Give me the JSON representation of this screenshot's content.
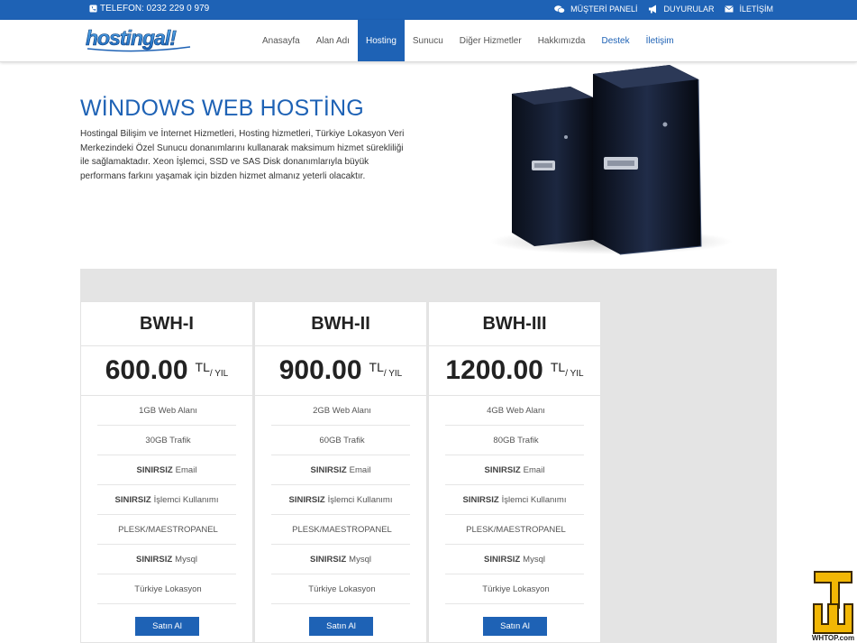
{
  "topbar": {
    "phone": "TELEFON: 0232 229 0 979",
    "links": [
      {
        "label": "MÜŞTERİ PANELİ",
        "icon": "chat-icon"
      },
      {
        "label": "DUYURULAR",
        "icon": "megaphone-icon"
      },
      {
        "label": "İLETİŞİM",
        "icon": "mail-icon"
      }
    ]
  },
  "logo": {
    "text": "hostingal!"
  },
  "menu": [
    {
      "label": "Anasayfa"
    },
    {
      "label": "Alan Adı"
    },
    {
      "label": "Hosting"
    },
    {
      "label": "Sunucu"
    },
    {
      "label": "Diğer Hizmetler"
    },
    {
      "label": "Hakkımızda"
    },
    {
      "label": "Destek"
    },
    {
      "label": "İletişim"
    }
  ],
  "hero": {
    "title": "WİNDOWS WEB HOSTİNG",
    "text": "Hostingal Bilişim ve İnternet Hizmetleri, Hosting hizmetleri, Türkiye Lokasyon Veri Merkezindeki Özel Sunucu donanımlarını kullanarak maksimum hizmet sürekliliği ile sağlamaktadır. Xeon İşlemci, SSD ve SAS Disk donanımlarıyla büyük performans farkını yaşamak için bizden hizmet almanız yeterli olacaktır."
  },
  "plans": [
    {
      "name": "BWH-I",
      "price": "600.00",
      "currency": "TL",
      "period": "/ YIL",
      "features": [
        {
          "bold": "",
          "text": "1GB Web Alanı"
        },
        {
          "bold": "",
          "text": "30GB Trafik"
        },
        {
          "bold": "SINIRSIZ",
          "text": "Email"
        },
        {
          "bold": "SINIRSIZ",
          "text": "İşlemci Kullanımı"
        },
        {
          "bold": "",
          "text": "PLESK/MAESTROPANEL"
        },
        {
          "bold": "SINIRSIZ",
          "text": "Mysql"
        },
        {
          "bold": "",
          "text": "Türkiye Lokasyon"
        }
      ],
      "button": "Satın Al"
    },
    {
      "name": "BWH-II",
      "price": "900.00",
      "currency": "TL",
      "period": "/ YIL",
      "features": [
        {
          "bold": "",
          "text": "2GB Web Alanı"
        },
        {
          "bold": "",
          "text": "60GB Trafik"
        },
        {
          "bold": "SINIRSIZ",
          "text": "Email"
        },
        {
          "bold": "SINIRSIZ",
          "text": "İşlemci Kullanımı"
        },
        {
          "bold": "",
          "text": "PLESK/MAESTROPANEL"
        },
        {
          "bold": "SINIRSIZ",
          "text": "Mysql"
        },
        {
          "bold": "",
          "text": "Türkiye Lokasyon"
        }
      ],
      "button": "Satın Al"
    },
    {
      "name": "BWH-III",
      "price": "1200.00",
      "currency": "TL",
      "period": "/ YIL",
      "features": [
        {
          "bold": "",
          "text": "4GB Web Alanı"
        },
        {
          "bold": "",
          "text": "80GB Trafik"
        },
        {
          "bold": "SINIRSIZ",
          "text": "Email"
        },
        {
          "bold": "SINIRSIZ",
          "text": "İşlemci Kullanımı"
        },
        {
          "bold": "",
          "text": "PLESK/MAESTROPANEL"
        },
        {
          "bold": "SINIRSIZ",
          "text": "Mysql"
        },
        {
          "bold": "",
          "text": "Türkiye Lokasyon"
        }
      ],
      "button": "Satın Al"
    }
  ],
  "badge": {
    "text": "WHTOP.com"
  },
  "colors": {
    "accent": "#1e62b5",
    "pricing_bg": "#e4e4e4"
  }
}
